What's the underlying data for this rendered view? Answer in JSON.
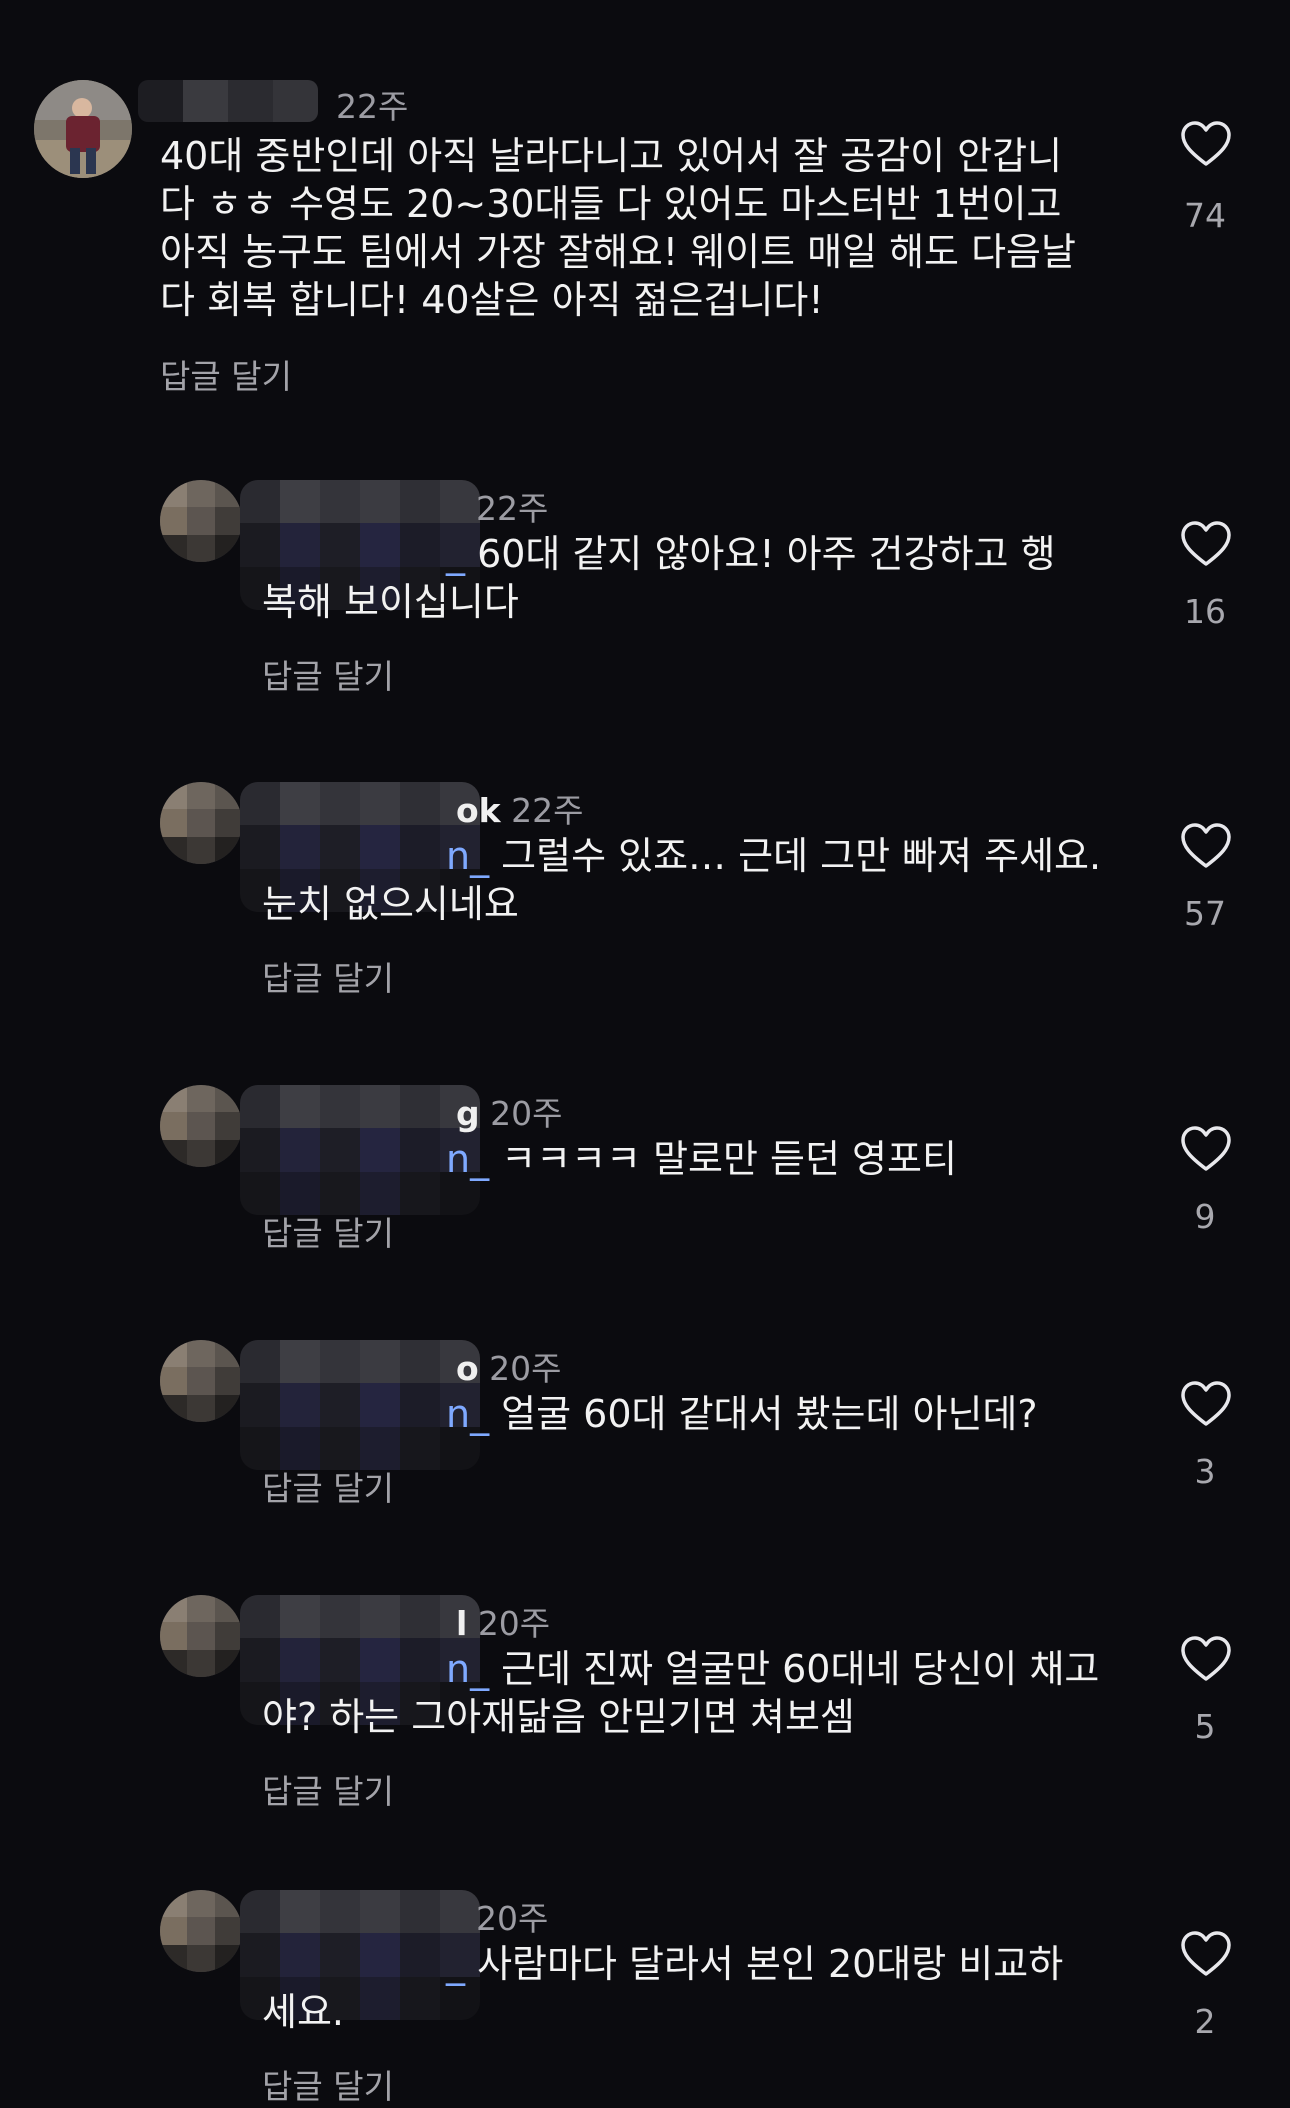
{
  "reply_label": "답글 달기",
  "top_comment": {
    "time": "22주",
    "text": "40대 중반인데 아직 날라다니고 있어서 잘 공감이 안갑니\n다 ㅎㅎ 수영도 20~30대들 다 있어도 마스터반 1번이고\n아직 농구도 팀에서 가장 잘해요! 웨이트 매일 해도 다음날\n다 회복 합니다! 40살은 아직 젊은겁니다!",
    "likes": "74"
  },
  "replies": [
    {
      "time": "22주",
      "handle_tail": "",
      "mention_tail": "_",
      "line1": " 60대 같지 않아요! 아주 건강하고 행",
      "line2": "복해 보이십니다",
      "likes": "16"
    },
    {
      "time": "22주",
      "handle_tail": "ok",
      "mention_tail": "n_",
      "line1": " 그럴수 있죠… 근데 그만 빠져 주세요.",
      "line2": "눈치 없으시네요",
      "likes": "57"
    },
    {
      "time": "20주",
      "handle_tail": "g",
      "mention_tail": "n_",
      "line1": " ㅋㅋㅋㅋ 말로만 듣던 영포티",
      "line2": "",
      "likes": "9"
    },
    {
      "time": "20주",
      "handle_tail": "o",
      "mention_tail": "n_",
      "line1": " 얼굴 60대 같대서 봤는데 아닌데?",
      "line2": "",
      "likes": "3"
    },
    {
      "time": "20주",
      "handle_tail": "l",
      "mention_tail": "n_",
      "line1": " 근데 진짜 얼굴만 60대네 당신이 채고",
      "line2": "야? 하는 그아재닮음 안믿기면 쳐보셈",
      "likes": "5"
    },
    {
      "time": "20주",
      "handle_tail": "",
      "mention_tail": "_",
      "line1": " 사람마다 달라서 본인 20대랑 비교하",
      "line2": "세요.",
      "likes": "2"
    }
  ],
  "colors": {
    "background": "#0b0b0f",
    "text": "#f2f2f2",
    "secondary": "#9c9ca3",
    "mention": "#7fa9ff"
  },
  "icons": {
    "like": "heart-outline-icon"
  }
}
